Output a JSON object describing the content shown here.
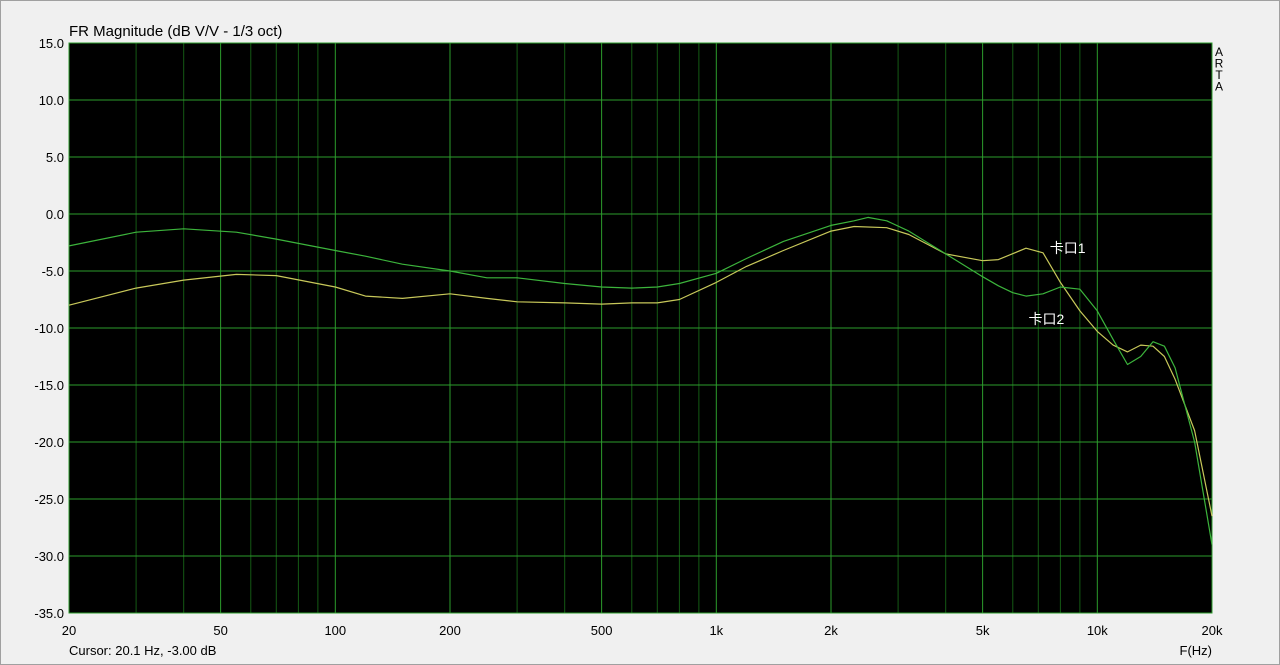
{
  "chart_data": {
    "type": "line",
    "title": "FR Magnitude (dB V/V - 1/3 oct)",
    "xlabel": "F(Hz)",
    "ylabel": "",
    "xscale": "log",
    "xlim": [
      20,
      20000
    ],
    "ylim": [
      -35,
      15
    ],
    "grid": true,
    "x_ticks": [
      20,
      50,
      100,
      200,
      500,
      1000,
      2000,
      5000,
      10000,
      20000
    ],
    "x_tick_labels": [
      "20",
      "50",
      "100",
      "200",
      "500",
      "1k",
      "2k",
      "5k",
      "10k",
      "20k"
    ],
    "y_ticks": [
      15,
      10,
      5,
      0,
      -5,
      -10,
      -15,
      -20,
      -25,
      -30,
      -35
    ],
    "y_tick_labels": [
      "15.0",
      "10.0",
      "5.0",
      "0.0",
      "-5.0",
      "-10.0",
      "-15.0",
      "-20.0",
      "-25.0",
      "-30.0",
      "-35.0"
    ],
    "watermark": "ARTA",
    "cursor_text": "Cursor: 20.1 Hz, -3.00 dB",
    "series": [
      {
        "name": "卡口1",
        "color": "#c8c85a",
        "x": [
          20,
          30,
          40,
          55,
          70,
          100,
          120,
          150,
          200,
          250,
          300,
          400,
          500,
          600,
          700,
          800,
          1000,
          1200,
          1500,
          2000,
          2300,
          2800,
          3200,
          4000,
          5000,
          5500,
          6500,
          7200,
          8000,
          9000,
          10000,
          11000,
          12000,
          13000,
          14000,
          15000,
          16000,
          18000,
          20000
        ],
        "y": [
          -8.0,
          -6.5,
          -5.8,
          -5.3,
          -5.4,
          -6.4,
          -7.2,
          -7.4,
          -7.0,
          -7.4,
          -7.7,
          -7.8,
          -7.9,
          -7.8,
          -7.8,
          -7.5,
          -6.0,
          -4.6,
          -3.2,
          -1.5,
          -1.1,
          -1.2,
          -1.8,
          -3.5,
          -4.1,
          -4.0,
          -3.0,
          -3.4,
          -6.0,
          -8.5,
          -10.3,
          -11.5,
          -12.1,
          -11.5,
          -11.6,
          -12.5,
          -14.5,
          -19.0,
          -26.5
        ]
      },
      {
        "name": "卡口2",
        "color": "#3cb43c",
        "x": [
          20,
          30,
          40,
          55,
          70,
          100,
          120,
          150,
          200,
          250,
          300,
          400,
          500,
          600,
          700,
          800,
          1000,
          1200,
          1500,
          2000,
          2300,
          2500,
          2800,
          3200,
          4000,
          5000,
          5500,
          6000,
          6500,
          7200,
          8000,
          9000,
          10000,
          11000,
          12000,
          13000,
          14000,
          15000,
          16000,
          18000,
          20000
        ],
        "y": [
          -2.8,
          -1.6,
          -1.3,
          -1.6,
          -2.2,
          -3.2,
          -3.7,
          -4.4,
          -5.0,
          -5.6,
          -5.6,
          -6.1,
          -6.4,
          -6.5,
          -6.4,
          -6.1,
          -5.2,
          -3.9,
          -2.4,
          -1.0,
          -0.6,
          -0.3,
          -0.6,
          -1.5,
          -3.5,
          -5.5,
          -6.3,
          -6.9,
          -7.2,
          -7.0,
          -6.4,
          -6.6,
          -8.5,
          -11.0,
          -13.2,
          -12.5,
          -11.2,
          -11.6,
          -13.5,
          -20.0,
          -29.0
        ]
      }
    ],
    "annotations": [
      {
        "text": "卡口1",
        "x": 7500,
        "y": -3.0
      },
      {
        "text": "卡口2",
        "x": 6600,
        "y": -9.2
      }
    ]
  }
}
